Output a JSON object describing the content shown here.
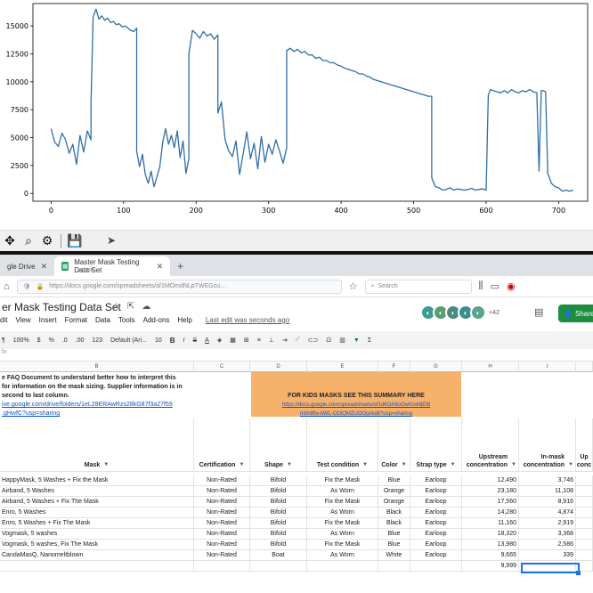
{
  "chart_data": {
    "type": "line",
    "color": "#2f6ea5",
    "xlim": [
      -25,
      740
    ],
    "ylim": [
      -700,
      17000
    ],
    "xticks": [
      "0",
      "100",
      "200",
      "300",
      "400",
      "500",
      "600",
      "700"
    ],
    "yticks": [
      "0",
      "2500",
      "5000",
      "7500",
      "10000",
      "12500",
      "15000"
    ],
    "segments": [
      {
        "x": [
          0,
          5,
          10,
          15,
          20,
          25,
          30,
          35,
          40,
          45,
          50,
          55
        ],
        "y": [
          5800,
          4600,
          4200,
          5400,
          4800,
          3600,
          4400,
          2600,
          5200,
          3700,
          5600,
          4800
        ]
      },
      {
        "x": [
          55,
          58,
          62,
          66,
          70,
          74,
          78,
          82,
          86,
          90,
          94,
          98,
          102,
          106,
          110,
          114,
          118
        ],
        "y": [
          8000,
          15800,
          16500,
          15600,
          15900,
          15500,
          15700,
          15300,
          15400,
          15100,
          15200,
          14900,
          15000,
          14800,
          14600,
          14500,
          14800
        ]
      },
      {
        "x": [
          118,
          122,
          126,
          130,
          134,
          138,
          142,
          146,
          150,
          154,
          158,
          162,
          166,
          170,
          174,
          178,
          182,
          186,
          190
        ],
        "y": [
          3800,
          2400,
          3500,
          1700,
          900,
          2000,
          600,
          1500,
          2400,
          4600,
          5800,
          4400,
          5200,
          4100,
          5600,
          3200,
          4700,
          1800,
          3100
        ]
      },
      {
        "x": [
          190,
          195,
          200,
          205,
          210,
          215,
          220,
          225,
          230
        ],
        "y": [
          12500,
          14600,
          14300,
          13900,
          14500,
          14100,
          14300,
          13800,
          14200
        ]
      },
      {
        "x": [
          230,
          235,
          240,
          245,
          250,
          255,
          260,
          265,
          270,
          275,
          280,
          285,
          290,
          295,
          300,
          305,
          310,
          315,
          320,
          325
        ],
        "y": [
          7200,
          8200,
          4800,
          3800,
          3300,
          4700,
          1700,
          3600,
          5500,
          3100,
          4500,
          2200,
          5100,
          2800,
          4400,
          3500,
          4800,
          3800,
          2700,
          4100
        ]
      },
      {
        "x": [
          325,
          330,
          335,
          340,
          345,
          350,
          355,
          360,
          365,
          370,
          375,
          380,
          385,
          390,
          395,
          400,
          405,
          410,
          415,
          420,
          425,
          430,
          435,
          440,
          445,
          450,
          455,
          460,
          465,
          470,
          475,
          480,
          485,
          490,
          495,
          500,
          505,
          510,
          515,
          520,
          525
        ],
        "y": [
          12800,
          13000,
          12700,
          12900,
          12600,
          12700,
          12400,
          12400,
          12100,
          12200,
          11900,
          11900,
          11700,
          11700,
          11500,
          11400,
          11200,
          11100,
          11000,
          10900,
          10700,
          10700,
          10500,
          10400,
          10200,
          10100,
          10000,
          9900,
          9800,
          9700,
          9600,
          9500,
          9400,
          9300,
          9200,
          9100,
          9000,
          8900,
          8800,
          8700,
          8700
        ]
      },
      {
        "x": [
          525,
          530,
          535,
          540,
          545,
          550,
          555,
          560,
          565,
          570,
          575,
          580,
          585,
          590,
          595,
          600
        ],
        "y": [
          1400,
          600,
          500,
          300,
          350,
          500,
          300,
          400,
          350,
          300,
          350,
          450,
          300,
          350,
          400,
          300
        ]
      },
      {
        "x": [
          600,
          603,
          606,
          610,
          615,
          620,
          625,
          630,
          635,
          640,
          645,
          650,
          655,
          660,
          665,
          670
        ],
        "y": [
          300,
          8800,
          9300,
          9200,
          9100,
          9000,
          9200,
          9000,
          9300,
          9100,
          9000,
          9200,
          9100,
          9300,
          9100,
          9000
        ]
      },
      {
        "x": [
          670,
          673,
          676,
          679,
          682
        ],
        "y": [
          8800,
          2000,
          9200,
          9200,
          9100
        ]
      },
      {
        "x": [
          682,
          685,
          690,
          695,
          700,
          705,
          710,
          715,
          720
        ],
        "y": [
          9000,
          1800,
          900,
          600,
          500,
          200,
          300,
          200,
          300
        ]
      }
    ]
  },
  "mpl_toolbar": {
    "pan": "✥",
    "zoom": "⌕",
    "config": "⚙",
    "save": "💾"
  },
  "browser": {
    "tab_left": "gle Drive",
    "tab_active": "Master Mask Testing Data Set",
    "tab_active_sub": "YIUTBE",
    "url": "https://docs.google.com/spreadsheets/d/1MOmdNLpTWEGcu...",
    "search_placeholder": "Search"
  },
  "sheets": {
    "title": "er Mask Testing Data Set",
    "menus": [
      "dit",
      "View",
      "Insert",
      "Format",
      "Data",
      "Tools",
      "Add-ons",
      "Help"
    ],
    "last_edit": "Last edit was seconds ago",
    "more_count": "+42",
    "share_label": "Share",
    "zoom": "100%",
    "format_num": "123",
    "font": "Default (Ari...",
    "font_size": "10"
  },
  "grid": {
    "col_letters": [
      "B",
      "C",
      "D",
      "E",
      "F",
      "G",
      "H",
      "I"
    ],
    "info_line1": "e FAQ Document to understand better how to interpret this",
    "info_line2": " for information on the mask sizing. Supplier information is in",
    "info_line3": "second to last column.",
    "info_link1": "ive.google.com/drive/folders/1eL28ERAwRzs28kG87f3a27f59",
    "info_link2": ".gHwfC?usp=sharing",
    "kids_title": "FOR KIDS MASKS SEE THIS SUMMARY HERE",
    "kids_link1": "https://docs.google.com/spreadsheets/d/1d6OAItoOwtUsMjEt8",
    "kids_link2": "mhh8fw-itWL-ODlQMZUOOjs/edit?usp=sharing",
    "headers": [
      "Mask",
      "Certification",
      "Shape",
      "Test condition",
      "Color",
      "Strap type",
      "Upstream concentration",
      "In-mask concentration",
      "Up conc"
    ],
    "rows": [
      [
        "HappyMask, 5 Washes + Fix the Mask",
        "Non-Rated",
        "Bifold",
        "Fix the Mask",
        "Blue",
        "Earloop",
        "12,490",
        "3,746"
      ],
      [
        "Airband, 5 Washes",
        "Non-Rated",
        "Bifold",
        "As Worn",
        "Orange",
        "Earloop",
        "23,180",
        "11,108"
      ],
      [
        "Airband, 5 Washes + Fix The Mask",
        "Non-Rated",
        "Bifold",
        "Fix the Mask",
        "Orange",
        "Earloop",
        "17,560",
        "8,916"
      ],
      [
        "Enro, 5 Washes",
        "Non-Rated",
        "Bifold",
        "As Worn",
        "Black",
        "Earloop",
        "14,280",
        "4,874"
      ],
      [
        "Enro, 5 Washes + Fix The Mask",
        "Non-Rated",
        "Bifold",
        "Fix the Mask",
        "Black",
        "Earloop",
        "11,160",
        "2,919"
      ],
      [
        "Vogmask, 5 washes",
        "Non-Rated",
        "Bifold",
        "As Worn",
        "Blue",
        "Earloop",
        "18,320",
        "3,368"
      ],
      [
        "Vogmask, 5 washes,  Fix The Mask",
        "Non-Rated",
        "Bifold",
        "Fix the Mask",
        "Blue",
        "Earloop",
        "13,980",
        "2,586"
      ],
      [
        "CandaMasQ, Nanomeltblown",
        "Non-Rated",
        "Boat",
        "As Worn",
        "White",
        "Earloop",
        "9,665",
        "339"
      ]
    ],
    "extra_value": "9,999"
  }
}
